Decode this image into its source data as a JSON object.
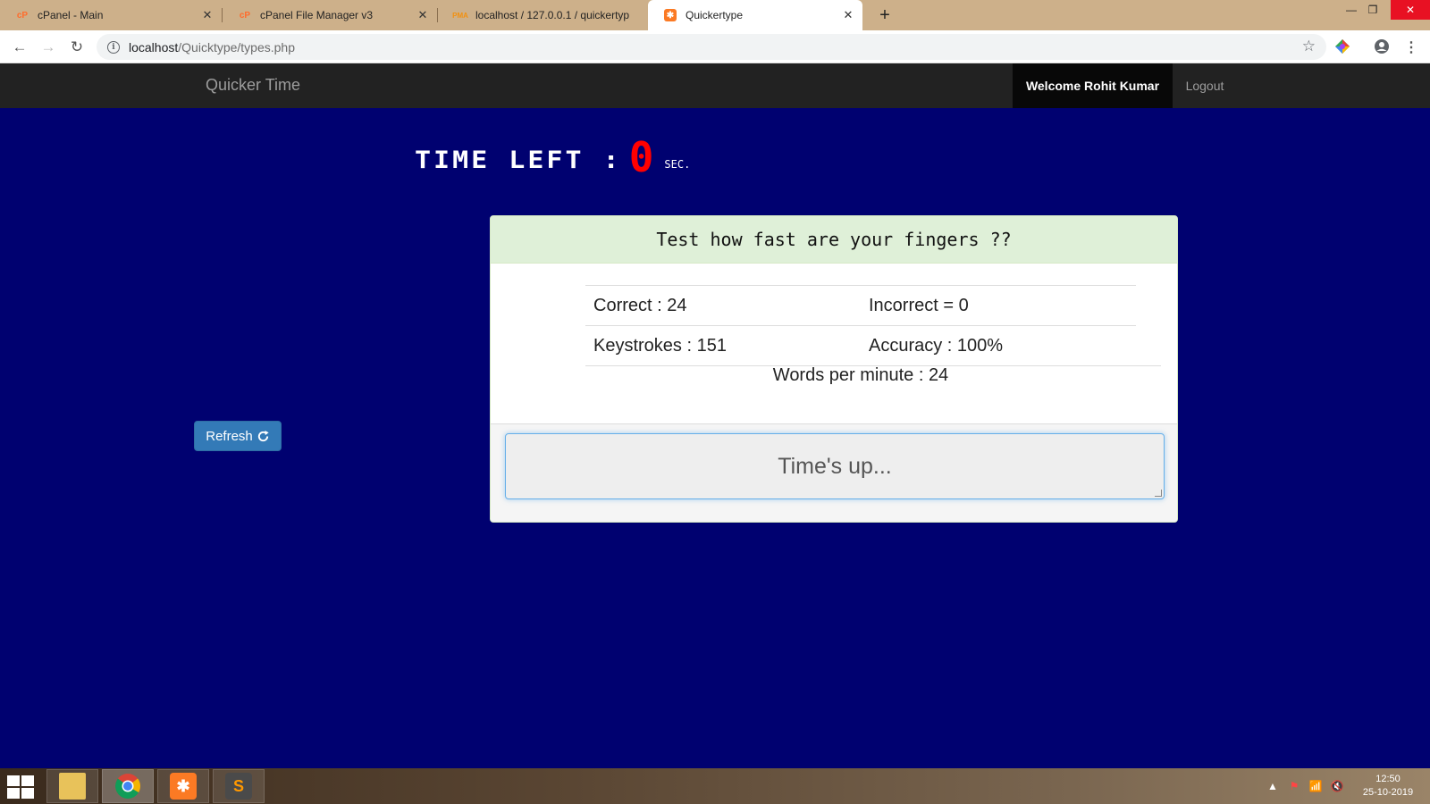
{
  "browser": {
    "tabs": [
      {
        "title": "cPanel - Main",
        "active": false
      },
      {
        "title": "cPanel File Manager v3",
        "active": false
      },
      {
        "title": "localhost / 127.0.0.1 / quickertyp",
        "active": false
      },
      {
        "title": "Quickertype",
        "active": true
      }
    ],
    "url_host": "localhost",
    "url_path": "/Quicktype/types.php"
  },
  "navbar": {
    "brand": "Quicker Time",
    "welcome": "Welcome Rohit Kumar",
    "logout": "Logout"
  },
  "timer": {
    "label": "TIME LEFT :",
    "value": "0",
    "unit": "SEC."
  },
  "refresh_label": "Refresh",
  "panel": {
    "heading": "Test how fast are your fingers ??",
    "correct": "Correct : 24",
    "incorrect": "Incorrect = 0",
    "keystrokes": "Keystrokes : 151",
    "accuracy": "Accuracy : 100%",
    "wpm": "Words per minute : 24",
    "answer_text": "Time's up..."
  },
  "taskbar": {
    "time": "12:50",
    "date": "25-10-2019"
  },
  "colors": {
    "page_bg": "#000170",
    "navbar_bg": "#222222",
    "panel_heading_bg": "#dff0d8",
    "timer_digit": "#ff0000",
    "refresh_button": "#337ab7"
  }
}
